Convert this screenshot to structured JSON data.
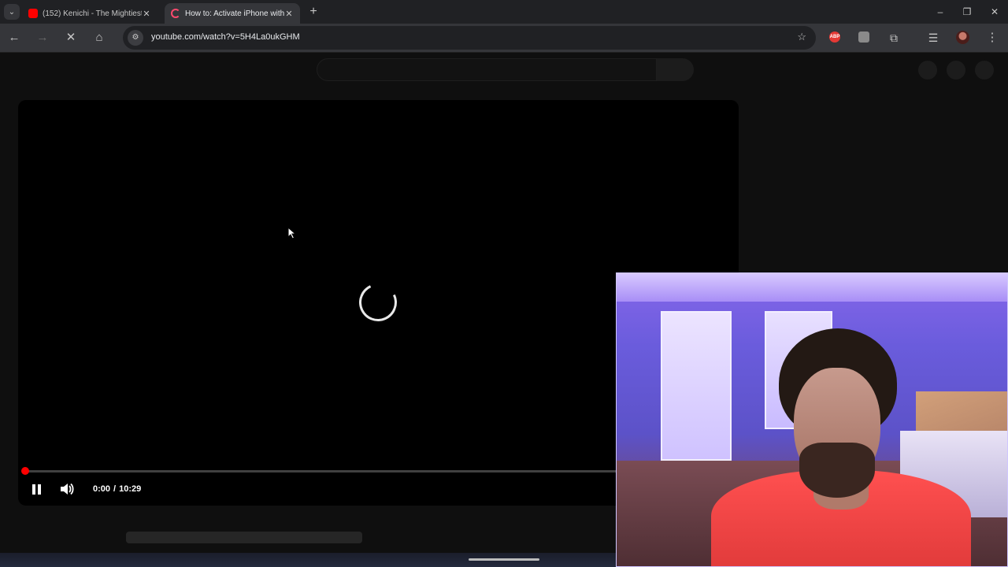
{
  "browser": {
    "tabs": [
      {
        "title": "(152) Kenichi - The Mightiest",
        "state": "inactive"
      },
      {
        "title": "How to: Activate iPhone with",
        "state": "active"
      }
    ],
    "url": "youtube.com/watch?v=5H4La0ukGHM",
    "extensions": [
      {
        "icon": "adblock-icon",
        "label": "ABP",
        "color": "#e53935"
      },
      {
        "icon": "extension-generic-icon",
        "label": "",
        "color": "#8a8a8a"
      }
    ],
    "colors": {
      "tabbar_bg": "#202124",
      "toolbar_bg": "#35363a",
      "youtube_red": "#ff0000"
    }
  },
  "player": {
    "current_time": "0:00",
    "duration": "10:29",
    "time_separator": "/",
    "progress_fraction": 0.0,
    "state": "loading"
  },
  "overlay": {
    "type": "webcam"
  }
}
